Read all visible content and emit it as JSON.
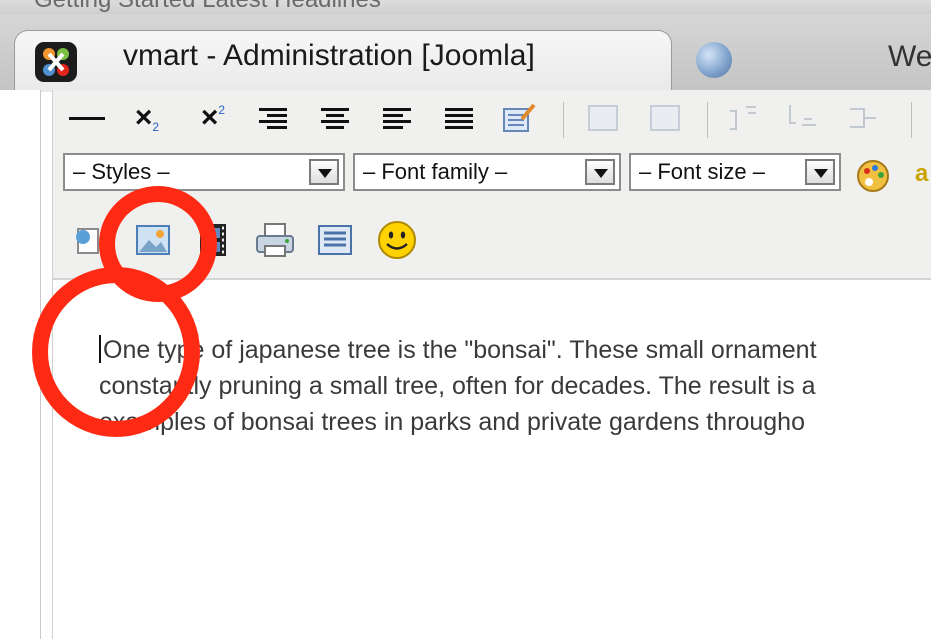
{
  "bookmarks": {
    "text": "Getting Started    Latest Headlines"
  },
  "tabs": [
    {
      "title": "vmart - Administration [Joomla]",
      "active": true,
      "icon": "joomla-icon"
    },
    {
      "title": "We",
      "active": false,
      "icon": "globe-icon"
    }
  ],
  "toolbar": {
    "row1_icons": [
      "horizontal-rule-icon",
      "subscript-icon",
      "superscript-icon",
      "align-right-icon",
      "align-center-icon",
      "align-left-icon",
      "align-justify-icon",
      "cleanup-icon",
      "table-icon",
      "table-props-icon",
      "row-before-icon",
      "row-after-icon",
      "delete-row-icon"
    ],
    "subscript_text": "×₂",
    "superscript_text": "×²",
    "styles_label": "– Styles –",
    "font_family_label": "– Font family –",
    "font_size_label": "– Font size –",
    "row3_icons": [
      "insert-link-icon",
      "insert-image-icon",
      "insert-media-icon",
      "print-icon",
      "fullscreen-icon",
      "emoticon-icon"
    ],
    "smiley": "☺"
  },
  "content": {
    "lines": [
      "One type of japanese tree is the \"bonsai\". These small ornament",
      "constantly pruning a small tree, often for decades. The result is a",
      "examples of bonsai trees in parks and private gardens througho"
    ]
  },
  "colors": {
    "annotation": "#ff2a14",
    "accent_yellow": "#ffd200"
  }
}
